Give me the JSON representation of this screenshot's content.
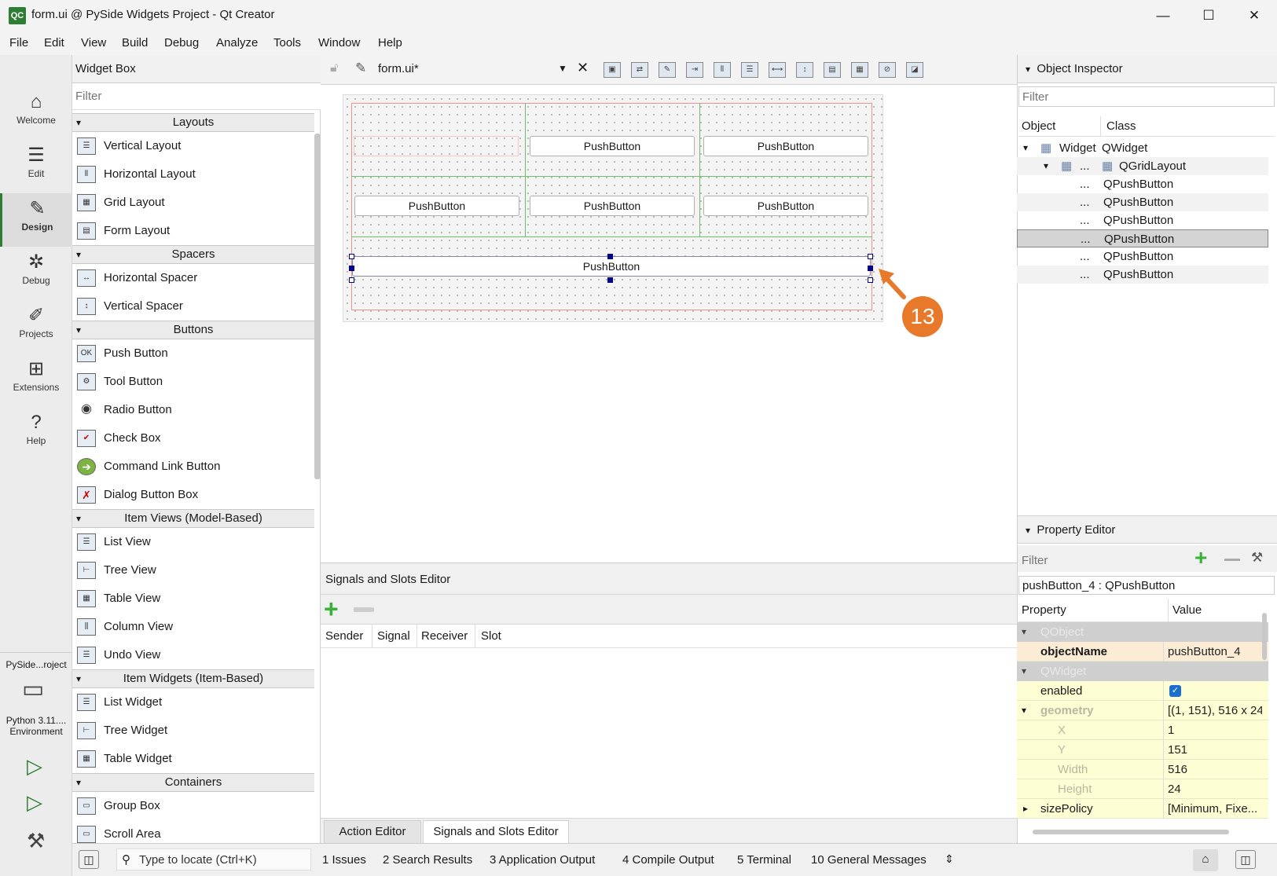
{
  "window": {
    "title": "form.ui @ PySide Widgets Project - Qt Creator",
    "app_icon": "QC",
    "minimize": "—",
    "maximize": "☐",
    "close": "✕"
  },
  "menu": [
    "File",
    "Edit",
    "View",
    "Build",
    "Debug",
    "Analyze",
    "Tools",
    "Window",
    "Help"
  ],
  "modes": [
    "Welcome",
    "Edit",
    "Design",
    "Debug",
    "Projects",
    "Extensions",
    "Help"
  ],
  "project_selector": {
    "project": "PySide...roject",
    "kit": "Python 3.11.... Environment"
  },
  "widget_box": {
    "title": "Widget Box",
    "filter_placeholder": "Filter",
    "categories": [
      {
        "name": "Layouts",
        "items": [
          "Vertical Layout",
          "Horizontal Layout",
          "Grid Layout",
          "Form Layout"
        ]
      },
      {
        "name": "Spacers",
        "items": [
          "Horizontal Spacer",
          "Vertical Spacer"
        ]
      },
      {
        "name": "Buttons",
        "items": [
          "Push Button",
          "Tool Button",
          "Radio Button",
          "Check Box",
          "Command Link Button",
          "Dialog Button Box"
        ]
      },
      {
        "name": "Item Views (Model-Based)",
        "items": [
          "List View",
          "Tree View",
          "Table View",
          "Column View",
          "Undo View"
        ]
      },
      {
        "name": "Item Widgets (Item-Based)",
        "items": [
          "List Widget",
          "Tree Widget",
          "Table Widget"
        ]
      },
      {
        "name": "Containers",
        "items": [
          "Group Box",
          "Scroll Area"
        ]
      }
    ]
  },
  "editor": {
    "document": "form.ui*"
  },
  "form": {
    "buttons": [
      "PushButton",
      "PushButton",
      "PushButton",
      "PushButton",
      "PushButton",
      "PushButton"
    ]
  },
  "callout": {
    "number": "13",
    "color": "#e8792b"
  },
  "signals_slots": {
    "title": "Signals and Slots Editor",
    "columns": [
      "Sender",
      "Signal",
      "Receiver",
      "Slot"
    ],
    "tabs": [
      "Action Editor",
      "Signals and Slots Editor"
    ]
  },
  "object_inspector": {
    "title": "Object Inspector",
    "filter_placeholder": "Filter",
    "columns": [
      "Object",
      "Class"
    ],
    "rows": [
      {
        "object": "Widget",
        "class": "QWidget"
      },
      {
        "object": "...",
        "class": "QGridLayout"
      },
      {
        "object": "...",
        "class": "QPushButton"
      },
      {
        "object": "...",
        "class": "QPushButton"
      },
      {
        "object": "...",
        "class": "QPushButton"
      },
      {
        "object": "...",
        "class": "QPushButton"
      },
      {
        "object": "...",
        "class": "QPushButton"
      },
      {
        "object": "...",
        "class": "QPushButton"
      }
    ]
  },
  "property_editor": {
    "title": "Property Editor",
    "filter_placeholder": "Filter",
    "selected": "pushButton_4 : QPushButton",
    "columns": [
      "Property",
      "Value"
    ],
    "sections": [
      "QObject",
      "QWidget"
    ],
    "rows": [
      {
        "property": "objectName",
        "value": "pushButton_4"
      },
      {
        "property": "enabled",
        "value": ""
      },
      {
        "property": "geometry",
        "value": "[(1, 151), 516 x 24]"
      },
      {
        "property": "X",
        "value": "1"
      },
      {
        "property": "Y",
        "value": "151"
      },
      {
        "property": "Width",
        "value": "516"
      },
      {
        "property": "Height",
        "value": "24"
      },
      {
        "property": "sizePolicy",
        "value": "[Minimum, Fixe..."
      }
    ]
  },
  "statusbar": {
    "locate_placeholder": "Type to locate (Ctrl+K)",
    "panes": [
      "1  Issues",
      "2  Search Results",
      "3  Application Output",
      "4  Compile Output",
      "5  Terminal",
      "10  General Messages"
    ]
  }
}
